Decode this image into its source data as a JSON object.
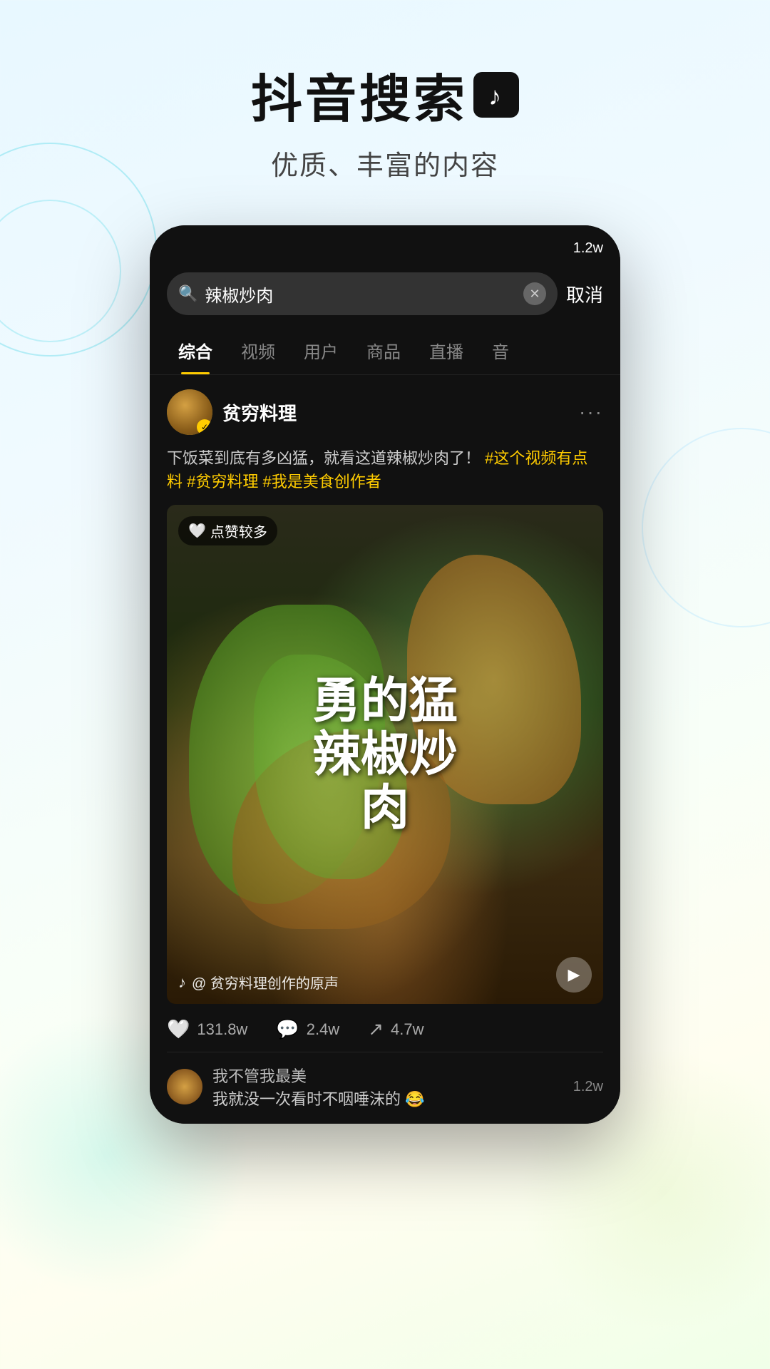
{
  "header": {
    "main_title": "抖音搜索",
    "subtitle": "优质、丰富的内容"
  },
  "phone": {
    "time": "1.2w"
  },
  "search": {
    "query": "辣椒炒肉",
    "cancel_label": "取消"
  },
  "tabs": [
    {
      "label": "综合",
      "active": true
    },
    {
      "label": "视频",
      "active": false
    },
    {
      "label": "用户",
      "active": false
    },
    {
      "label": "商品",
      "active": false
    },
    {
      "label": "直播",
      "active": false
    },
    {
      "label": "音",
      "active": false
    }
  ],
  "post": {
    "username": "贫穷料理",
    "description_plain": "下饭菜到底有多凶猛，就看这道辣椒炒肉了！",
    "hashtags": [
      "#这个视频有点料",
      "#贫穷料理",
      "#我是美食创作者"
    ],
    "like_badge": "点赞较多",
    "video_overlay_text": "勇的猛辣椒炒肉",
    "audio_text": "@ 贫穷料理创作的原声"
  },
  "stats": {
    "likes": "131.8w",
    "comments": "2.4w",
    "shares": "4.7w"
  },
  "comment": {
    "username": "我不管我最美",
    "text": "我就没一次看时不咽唾沫的 😂",
    "count": "1.2w"
  }
}
